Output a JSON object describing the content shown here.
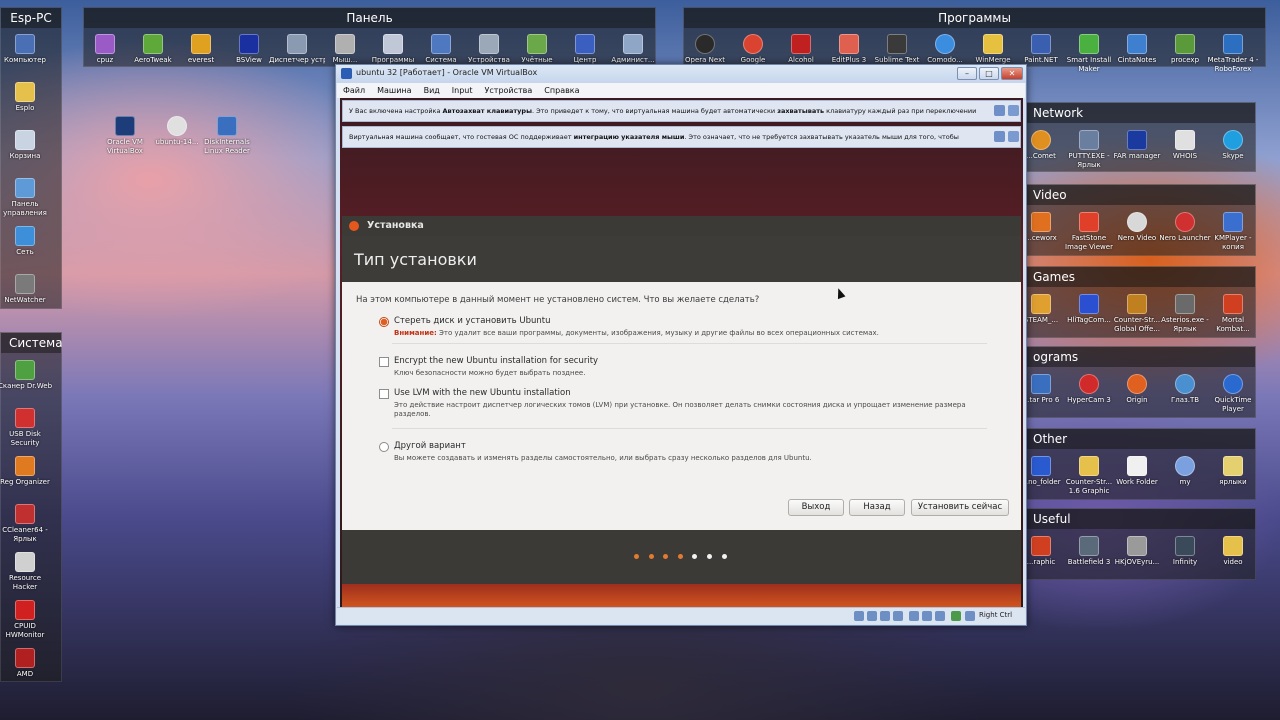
{
  "fences": {
    "esp_pc": "Esp-PC",
    "panel": "Панель",
    "programs": "Программы",
    "network": "Network",
    "video": "Video",
    "games": "Games",
    "programs2": "ograms",
    "sistema": "Система",
    "other": "Other",
    "useful": "Useful"
  },
  "icons": {
    "esp": [
      "Компьютер",
      "Esplo",
      "Корзина",
      "Панель управления",
      "Сеть",
      "NetWatcher"
    ],
    "panel": [
      "cpuz",
      "AeroTweak",
      "everest",
      "BSView",
      "Диспетчер устройст...",
      "Мыш...",
      "Программы",
      "Система",
      "Устройства",
      "Учётные",
      "Центр",
      "Админист..."
    ],
    "loose": [
      "Oracle VM VirtualBox",
      "ubuntu-14...",
      "DiskInternals Linux Reader"
    ],
    "programs": [
      "Opera Next",
      "Google",
      "Alcohol",
      "EditPlus 3",
      "Sublime Text",
      "Comodo...",
      "WinMerge",
      "Paint.NET",
      "Smart Install Maker",
      "CintaNotes",
      "procexp",
      "MetaTrader 4 - RoboForex"
    ],
    "network": [
      "...Comet",
      "PUTTY.EXE - Ярлык",
      "FAR manager",
      "WHOIS",
      "Skype"
    ],
    "video": [
      "...ceworx",
      "FastStone Image Viewer",
      "Nero Video",
      "Nero Launcher",
      "KMPlayer - копия"
    ],
    "games": [
      "STEAM_...",
      "HliTagCom...",
      "Counter-Str... Global Offe...",
      "Asterios.exe - Ярлык",
      "Mortal Kombat..."
    ],
    "programs2": [
      "...tar Pro 6",
      "HyperCam 3",
      "Origin",
      "Глаз.TB",
      "QuickTime Player"
    ],
    "sistema": [
      "Сканер Dr.Web",
      "USB Disk Security",
      "Reg Organizer",
      "CCleaner64 - Ярлык",
      "Resource Hacker",
      "CPUID HWMonitor",
      "AMD"
    ],
    "other": [
      "...no_folder",
      "Counter-Str... 1.6 Graphic",
      "Work Folder",
      "my",
      "ярлыки"
    ],
    "useful": [
      "...raphic",
      "Battlefield 3",
      "HKjOVEyru...",
      "Infinity",
      "video"
    ]
  },
  "vbox": {
    "title": "ubuntu 32 [Работает] - Oracle VM VirtualBox",
    "menu": [
      "Файл",
      "Машина",
      "Вид",
      "Input",
      "Устройства",
      "Справка"
    ],
    "notice1_pre": "У Вас включена настройка ",
    "notice1_b1": "Автозахват клавиатуры",
    "notice1_mid": ". Это приведет к тому, что виртуальная машина будет автоматически ",
    "notice1_b2": "захватывать",
    "notice1_post": " клавиатуру каждый раз при переключении",
    "notice2_pre": "Виртуальная машина сообщает, что гостевая ОС поддерживает ",
    "notice2_b": "интеграцию указателя мыши",
    "notice2_post": ". Это означает, что не требуется захватывать указатель мыши для того, чтобы",
    "status_key": "Right Ctrl"
  },
  "installer": {
    "window_title": "Установка",
    "heading": "Тип установки",
    "question": "На этом компьютере в данный момент не установлено систем. Что вы желаете сделать?",
    "opt1_label": "Стереть диск и установить Ubuntu",
    "opt1_warn": "Внимание:",
    "opt1_desc": " Это удалит все ваши программы, документы, изображения, музыку и другие файлы во всех операционных системах.",
    "opt2_label": "Encrypt the new Ubuntu installation for security",
    "opt2_desc": "Ключ безопасности можно будет выбрать позднее.",
    "opt3_label": "Use LVM with the new Ubuntu installation",
    "opt3_desc": "Это действие настроит диспетчер логических томов (LVM) при установке. Он позволяет делать снимки состояния диска и упрощает изменение размера разделов.",
    "opt4_label": "Другой вариант",
    "opt4_desc": "Вы можете создавать и изменять разделы самостоятельно, или выбрать сразу несколько разделов для Ubuntu.",
    "btn_quit": "Выход",
    "btn_back": "Назад",
    "btn_install": "Установить сейчас",
    "progress": {
      "completed": 4,
      "total": 7
    }
  }
}
